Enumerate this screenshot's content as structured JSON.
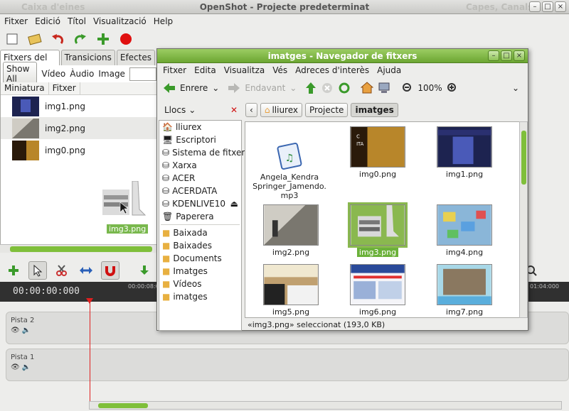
{
  "main": {
    "title": "OpenShot - Projecte predeterminat",
    "ghost_left": "Caixa d'eines",
    "ghost_right": "Capes, Canals",
    "menu": [
      "Fitxer",
      "Edició",
      "Títol",
      "Visualització",
      "Help"
    ],
    "tabs": [
      "Fitxers del projecte",
      "Transicions",
      "Efectes"
    ],
    "filters": {
      "show_all": "Show All",
      "video": "Vídeo",
      "audio": "Àudio",
      "image": "Image"
    },
    "columns": [
      "Miniatura",
      "Fitxer"
    ],
    "files": [
      {
        "name": "img1.png"
      },
      {
        "name": "img2.png"
      },
      {
        "name": "img0.png"
      }
    ],
    "drag_label": "img3.png",
    "timecode": "00:00:00:000",
    "ticks": [
      "00:00:08:0",
      "01:04:000"
    ],
    "tracks": [
      "Pista 2",
      "Pista 1"
    ]
  },
  "browser": {
    "title": "imatges - Navegador de fitxers",
    "menu": [
      "Fitxer",
      "Edita",
      "Visualitza",
      "Vés",
      "Adreces d'interès",
      "Ajuda"
    ],
    "back": "Enrere",
    "forward": "Endavant",
    "zoom": "100%",
    "places_label": "Llocs",
    "places": [
      "lliurex",
      "Escriptori",
      "Sistema de fitxers",
      "Xarxa",
      "ACER",
      "ACERDATA",
      "KDENLIVE10",
      "Paperera"
    ],
    "bookmarks": [
      "Baixada",
      "Baixades",
      "Documents",
      "Imatges",
      "Vídeos",
      "imatges"
    ],
    "crumbs": [
      "lliurex",
      "Projecte",
      "imatges"
    ],
    "files": [
      {
        "name": "Angela_Kendra Springer_Jamendo.mp3",
        "line1": "Angela_Kendra",
        "line2": "Springer_Jamendo.",
        "line3": "mp3"
      },
      {
        "name": "img0.png"
      },
      {
        "name": "img1.png"
      },
      {
        "name": "img2.png"
      },
      {
        "name": "img3.png"
      },
      {
        "name": "img4.png"
      },
      {
        "name": "img5.png"
      },
      {
        "name": "img6.png"
      },
      {
        "name": "img7.png"
      }
    ],
    "status": "«img3.png» seleccionat (193,0 KB)"
  }
}
